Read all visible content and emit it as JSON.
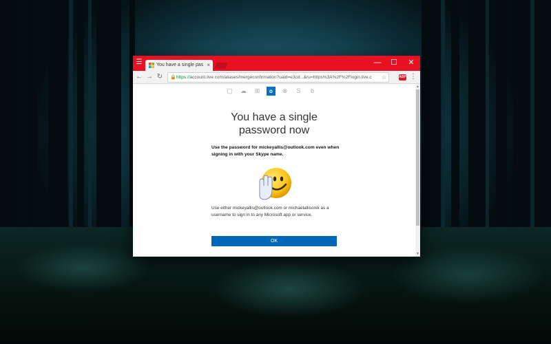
{
  "browser": {
    "tab_title": "You have a single passw",
    "tab_close": "×",
    "url_scheme": "https://",
    "url_rest": "account.live.com/aliases/mergeconfirmation?uaid=e3cd...&ru=https%3A%2F%2Flogin.live.c",
    "controls": {
      "minimize": "—",
      "maximize": "☐",
      "close": "✕"
    },
    "nav": {
      "back": "←",
      "forward": "→",
      "reload": "↻"
    },
    "extension_badge": "ABP"
  },
  "apps": [
    {
      "name": "Office",
      "glyph": "▢"
    },
    {
      "name": "OneDrive",
      "glyph": "☁"
    },
    {
      "name": "Windows",
      "glyph": "⊞"
    },
    {
      "name": "Outlook",
      "glyph": "o"
    },
    {
      "name": "Xbox",
      "glyph": "⊗"
    },
    {
      "name": "Skype",
      "glyph": "S"
    },
    {
      "name": "Bing",
      "glyph": "b"
    }
  ],
  "page": {
    "heading_line1": "You have a single",
    "heading_line2": "password now",
    "body": "Use the password for mickeyallis@outlook.com even when signing in with your Skype name.",
    "footer": "Use either mickeyallis@outlook.com or michaelallisonik as a username to sign in to any Microsoft app or service.",
    "ok_label": "OK"
  },
  "colors": {
    "titlebar": "#e81123",
    "primary_button": "#0067b8",
    "outlook_blue": "#0072c6"
  }
}
